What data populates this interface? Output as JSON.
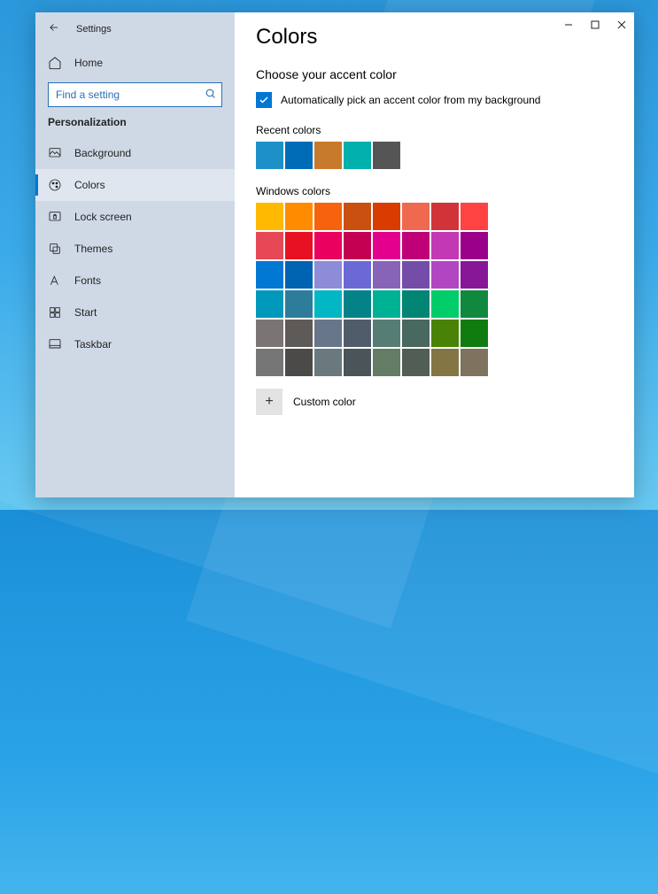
{
  "window_title": "Settings",
  "home_label": "Home",
  "search_placeholder": "Find a setting",
  "section_header": "Personalization",
  "nav": [
    {
      "key": "background",
      "label": "Background"
    },
    {
      "key": "colors",
      "label": "Colors"
    },
    {
      "key": "lockscreen",
      "label": "Lock screen"
    },
    {
      "key": "themes",
      "label": "Themes"
    },
    {
      "key": "fonts",
      "label": "Fonts"
    },
    {
      "key": "start",
      "label": "Start"
    },
    {
      "key": "taskbar",
      "label": "Taskbar"
    }
  ],
  "selected_nav": "colors",
  "page_heading": "Colors",
  "subheading": "Choose your accent color",
  "checkbox_label": "Automatically pick an accent color from my background",
  "checkbox_checked": true,
  "recent_label": "Recent colors",
  "recent_colors": [
    "#1e90c8",
    "#006cb8",
    "#c87a2c",
    "#00b0ac",
    "#555555"
  ],
  "windows_label": "Windows colors",
  "windows_colors": [
    "#ffb900",
    "#ff8c00",
    "#f7630c",
    "#ca5010",
    "#da3b01",
    "#ef6950",
    "#d13438",
    "#ff4343",
    "#e74856",
    "#e81123",
    "#ea005e",
    "#c30052",
    "#e3008c",
    "#bf0077",
    "#c239b3",
    "#9a0089",
    "#0078d4",
    "#0063b1",
    "#8e8cd8",
    "#6b69d6",
    "#8764b8",
    "#744da9",
    "#b146c2",
    "#881798",
    "#0099bc",
    "#2d7d9a",
    "#00b7c3",
    "#038387",
    "#00b294",
    "#018574",
    "#00cc6a",
    "#10893e",
    "#7a7574",
    "#5d5a58",
    "#68768a",
    "#515c6b",
    "#567c73",
    "#486860",
    "#498205",
    "#107c10",
    "#767676",
    "#4c4a48",
    "#69797e",
    "#4a5459",
    "#647c64",
    "#525e54",
    "#847545",
    "#7e735f"
  ],
  "custom_label": "Custom color"
}
